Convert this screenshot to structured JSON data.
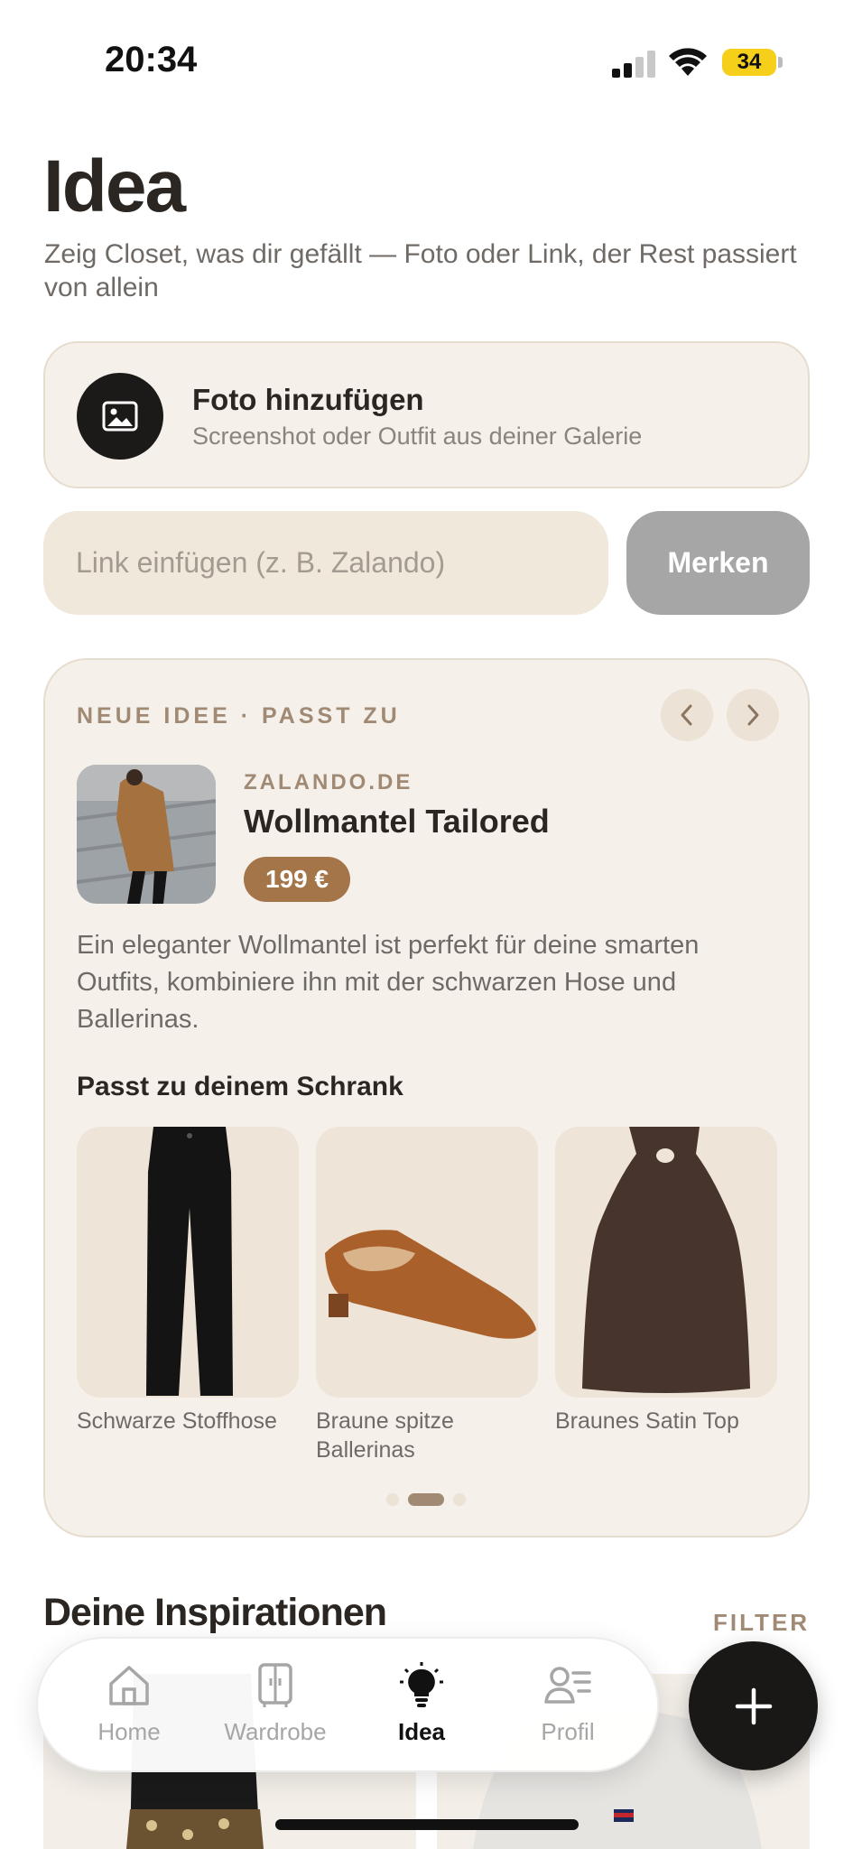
{
  "status_bar": {
    "time": "20:34",
    "battery": "34"
  },
  "header": {
    "title": "Idea",
    "subtitle": "Zeig Closet, was dir gefällt — Foto oder Link, der Rest passiert von allein"
  },
  "photo_card": {
    "title": "Foto hinzufügen",
    "subtitle": "Screenshot oder Outfit aus deiner Galerie",
    "icon": "image-icon"
  },
  "link_form": {
    "placeholder": "Link einfügen (z. B. Zalando)",
    "value": "",
    "button_label": "Merken"
  },
  "idea_card": {
    "kicker": "NEUE IDEE · PASST ZU",
    "shop": "ZALANDO.DE",
    "product": "Wollmantel Tailored",
    "price": "199 €",
    "description": "Ein eleganter Wollmantel ist perfekt für deine smarten Outfits, kombiniere ihn mit der schwarzen Hose und Ballerinas.",
    "match_heading": "Passt zu deinem Schrank",
    "matches": [
      {
        "label": "Schwarze Stoffhose",
        "icon": "trousers"
      },
      {
        "label": "Braune spitze Ballerinas",
        "icon": "ballerina-shoe"
      },
      {
        "label": "Braunes Satin Top",
        "icon": "halter-top"
      }
    ],
    "pagination": {
      "current": 2,
      "total": 3
    }
  },
  "inspirations": {
    "title": "Deine Inspirationen",
    "filter_label": "FILTER"
  },
  "tabbar": {
    "tabs": [
      {
        "label": "Home",
        "icon": "home-icon"
      },
      {
        "label": "Wardrobe",
        "icon": "wardrobe-icon"
      },
      {
        "label": "Idea",
        "icon": "lightbulb-icon",
        "active": true
      },
      {
        "label": "Profil",
        "icon": "profile-icon"
      }
    ]
  },
  "fab": {
    "icon": "plus-icon"
  },
  "colors": {
    "accent": "#a47548",
    "card_bg": "#f5f0ea",
    "muted_label": "#a08a74",
    "dark": "#1c1a18"
  }
}
